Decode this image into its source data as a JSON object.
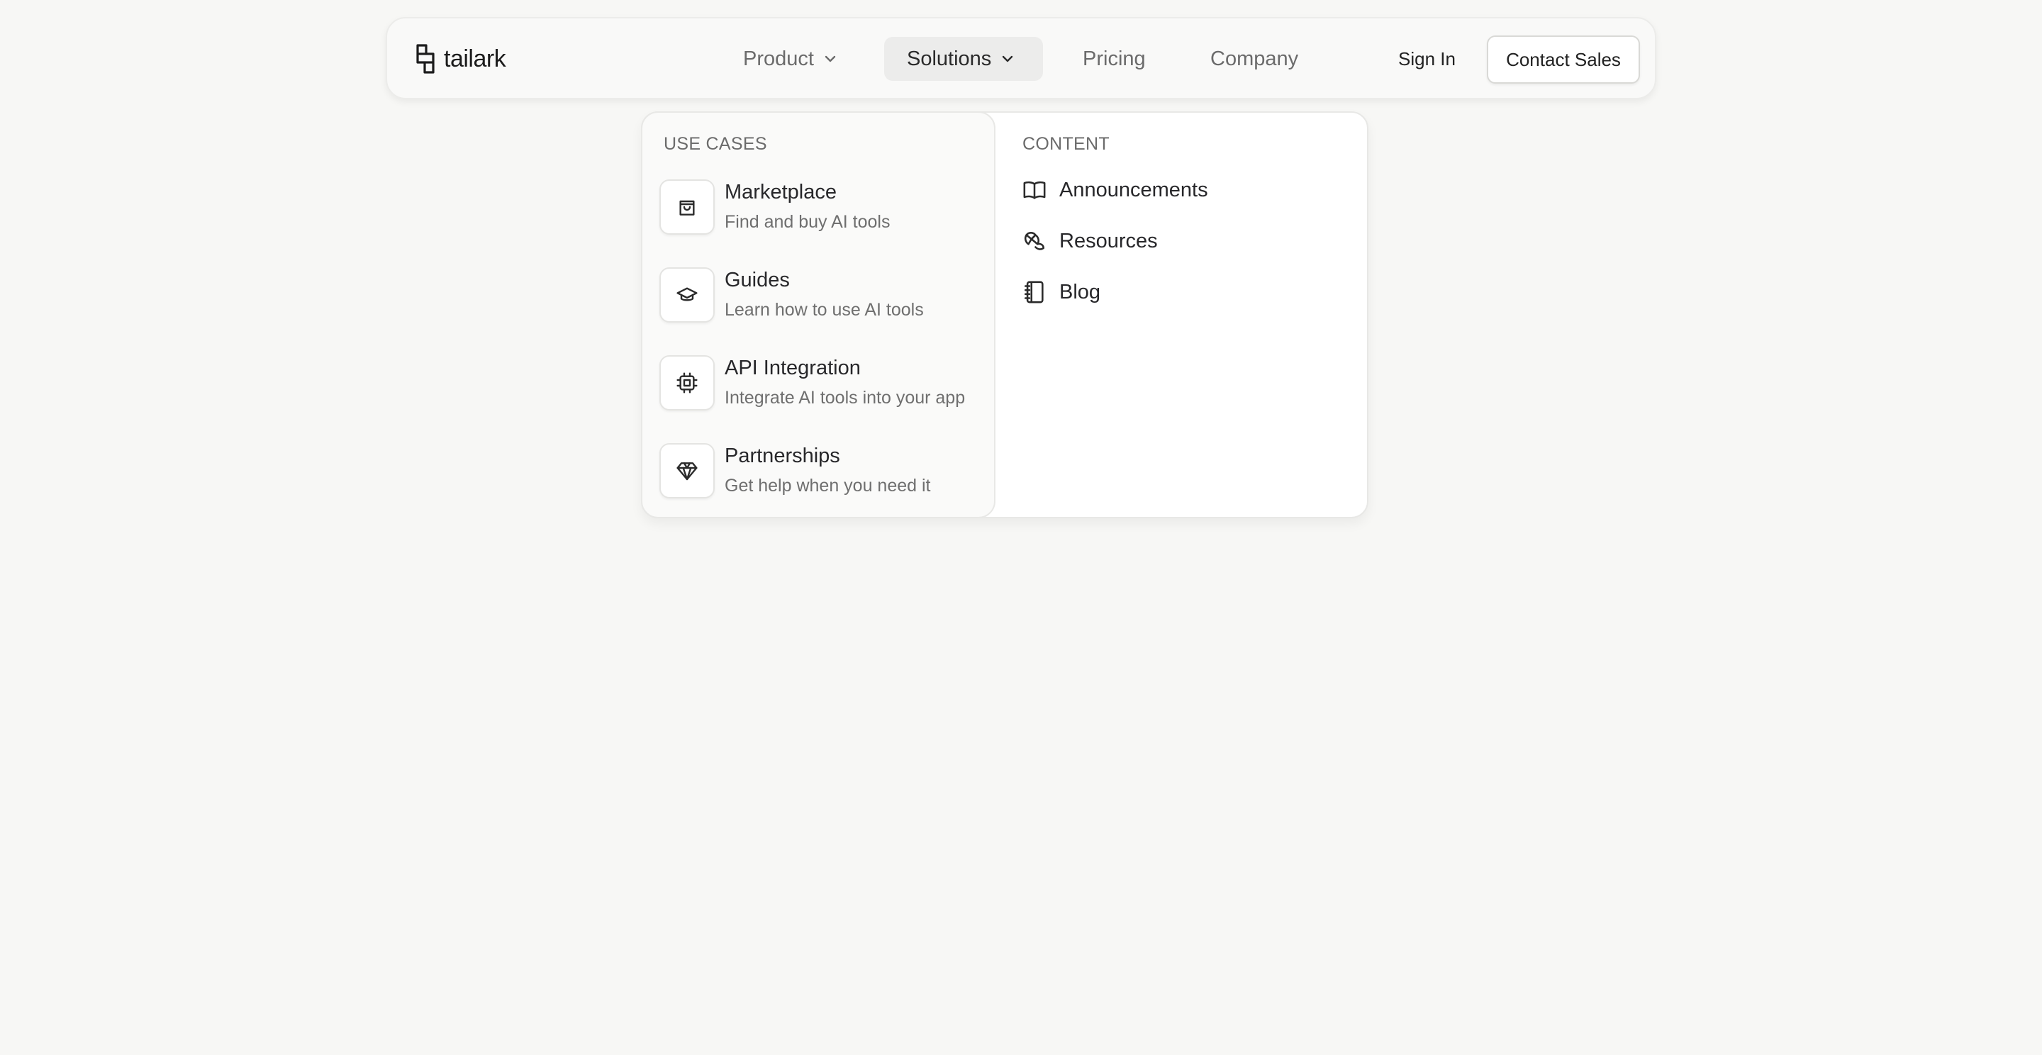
{
  "brand": {
    "name": "tailark",
    "icon": "tailark-logo"
  },
  "nav": {
    "items": [
      {
        "label": "Product",
        "has_dropdown": true,
        "active": false
      },
      {
        "label": "Solutions",
        "has_dropdown": true,
        "active": true
      },
      {
        "label": "Pricing",
        "has_dropdown": false,
        "active": false
      },
      {
        "label": "Company",
        "has_dropdown": false,
        "active": false
      }
    ],
    "sign_in_label": "Sign In",
    "contact_label": "Contact Sales"
  },
  "dropdown": {
    "use_cases_heading": "USE CASES",
    "use_cases": [
      {
        "title": "Marketplace",
        "description": "Find and buy AI tools",
        "icon": "shopping-bag-icon"
      },
      {
        "title": "Guides",
        "description": "Learn how to use AI tools",
        "icon": "graduation-cap-icon"
      },
      {
        "title": "API Integration",
        "description": "Integrate AI tools into your app",
        "icon": "cpu-chip-icon"
      },
      {
        "title": "Partnerships",
        "description": "Get help when you need it",
        "icon": "gem-icon"
      }
    ],
    "content_heading": "CONTENT",
    "content": [
      {
        "label": "Announcements",
        "icon": "open-book-icon"
      },
      {
        "label": "Resources",
        "icon": "croissant-icon"
      },
      {
        "label": "Blog",
        "icon": "notebook-icon"
      }
    ]
  },
  "colors": {
    "background": "#f7f7f5",
    "text": "#27272a",
    "muted_text": "#6b6b6b",
    "active_nav_bg": "#ececeb",
    "panel_bg": "#ffffff"
  }
}
